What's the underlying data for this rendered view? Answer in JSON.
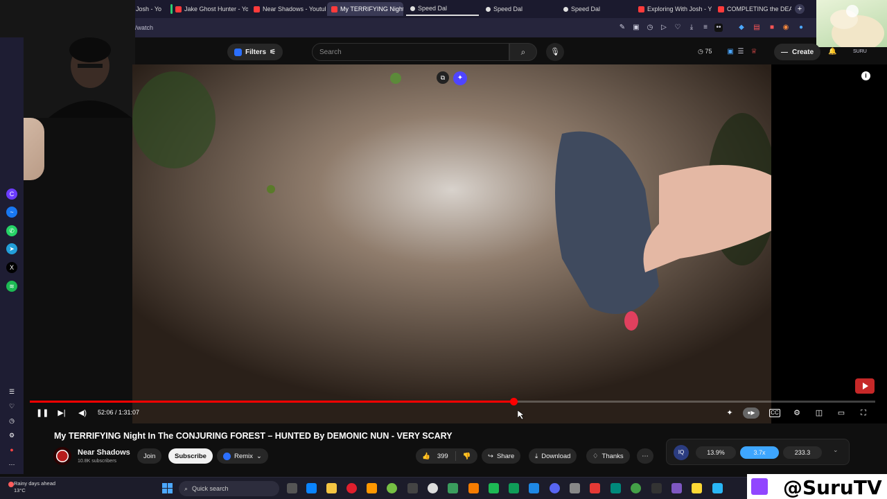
{
  "tabs": [
    {
      "label": "Josh - Yo",
      "icon": "youtube-icon"
    },
    {
      "label": "Jake Ghost Hunter - YouT",
      "icon": "youtube-icon"
    },
    {
      "label": "Near Shadows - Youtube",
      "icon": "youtube-icon"
    },
    {
      "label": "My TERRIFYING Night",
      "icon": "youtube-icon",
      "active": true
    },
    {
      "label": "Speed Dal",
      "icon": "speed-dial-icon"
    },
    {
      "label": "Speed Dal",
      "icon": "speed-dial-icon"
    },
    {
      "label": "Speed Dal",
      "icon": "speed-dial-icon"
    },
    {
      "label": "Exploring With Josh - You",
      "icon": "youtube-icon"
    },
    {
      "label": "COMPLETING the DEATH",
      "icon": "youtube-icon"
    }
  ],
  "address": {
    "url": "/watch"
  },
  "header": {
    "filters_label": "Filters",
    "search_placeholder": "Search",
    "counter": "75",
    "create_label": "Create"
  },
  "player": {
    "time": "52:06 / 1:31:07",
    "progress": 0.572
  },
  "video": {
    "title": "My TERRIFYING Night In The CONJURING FOREST – HUNTED By DEMONIC NUN - VERY SCARY"
  },
  "channel": {
    "name": "Near Shadows",
    "subscribers": "10.8K subscribers",
    "join_label": "Join",
    "subscribe_label": "Subscribe",
    "remix_label": "Remix"
  },
  "actions": {
    "likes": "399",
    "share_label": "Share",
    "download_label": "Download",
    "thanks_label": "Thanks"
  },
  "extension": {
    "values": [
      "13.9%",
      "3.7x",
      "233.3"
    ]
  },
  "taskbar": {
    "weather_line1": "Rainy days ahead",
    "weather_line2": "13°C",
    "search_label": "Quick search"
  },
  "branding": {
    "handle": "@SuruTV"
  },
  "colors": {
    "accent": "#ff0000",
    "twitch": "#9146ff",
    "ext_highlight": "#3ea6ff"
  }
}
